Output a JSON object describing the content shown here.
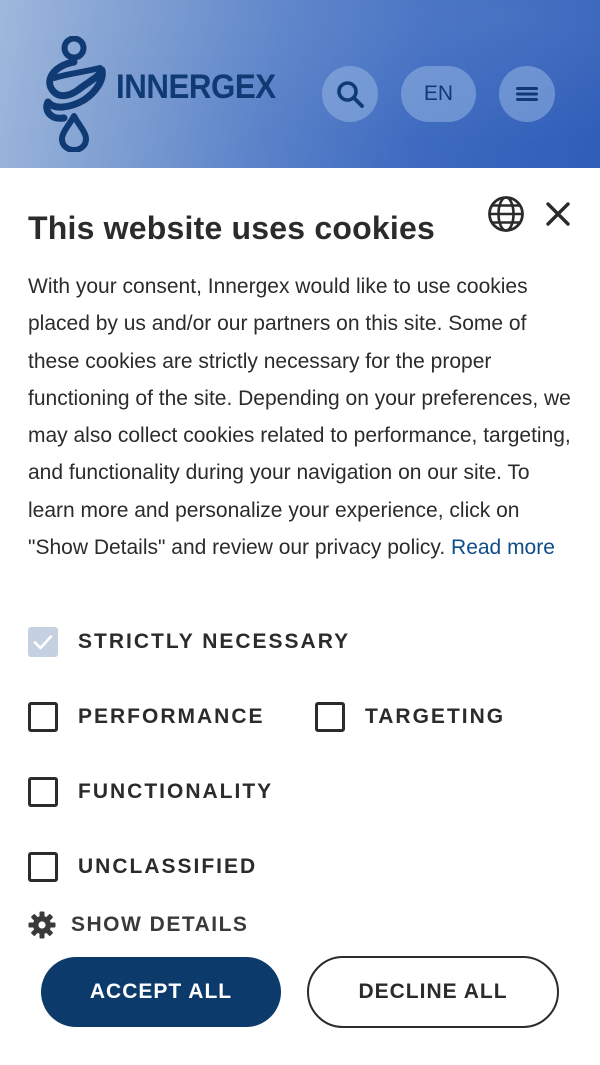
{
  "header": {
    "logo_text": "INNERGEX",
    "logo_icon": "innergex-logo-icon",
    "search_icon": "search-icon",
    "language_label": "EN",
    "menu_icon": "hamburger-menu-icon",
    "colors": {
      "brand_dark_blue": "#0f3a73",
      "header_gradient_start": "#9fb8dc",
      "header_gradient_end": "#2f5db8"
    }
  },
  "cookie_banner": {
    "title": "This website uses cookies",
    "language_icon": "globe-icon",
    "close_icon": "close-icon",
    "body_text": "With your consent, Innergex would like to use cookies placed by us and/or our partners on this site. Some of these cookies are strictly necessary for the proper functioning of the site. Depending on your preferences, we may also collect cookies related to performance, targeting, and functionality during your navigation on our site. To learn more and personalize your experience, click on \"Show Details\" and review our privacy policy. ",
    "read_more_label": "Read more",
    "categories": [
      {
        "label": "STRICTLY NECESSARY",
        "checked": true,
        "disabled": true
      },
      {
        "label": "PERFORMANCE",
        "checked": false,
        "disabled": false
      },
      {
        "label": "TARGETING",
        "checked": false,
        "disabled": false
      },
      {
        "label": "FUNCTIONALITY",
        "checked": false,
        "disabled": false
      },
      {
        "label": "UNCLASSIFIED",
        "checked": false,
        "disabled": false
      }
    ],
    "show_details_icon": "gear-icon",
    "show_details_label": "SHOW DETAILS",
    "accept_label": "ACCEPT ALL",
    "decline_label": "DECLINE ALL",
    "colors": {
      "accept_bg": "#0c3a6b",
      "link": "#0f4c8a",
      "disabled_checkbox": "#c5d1e0"
    }
  }
}
